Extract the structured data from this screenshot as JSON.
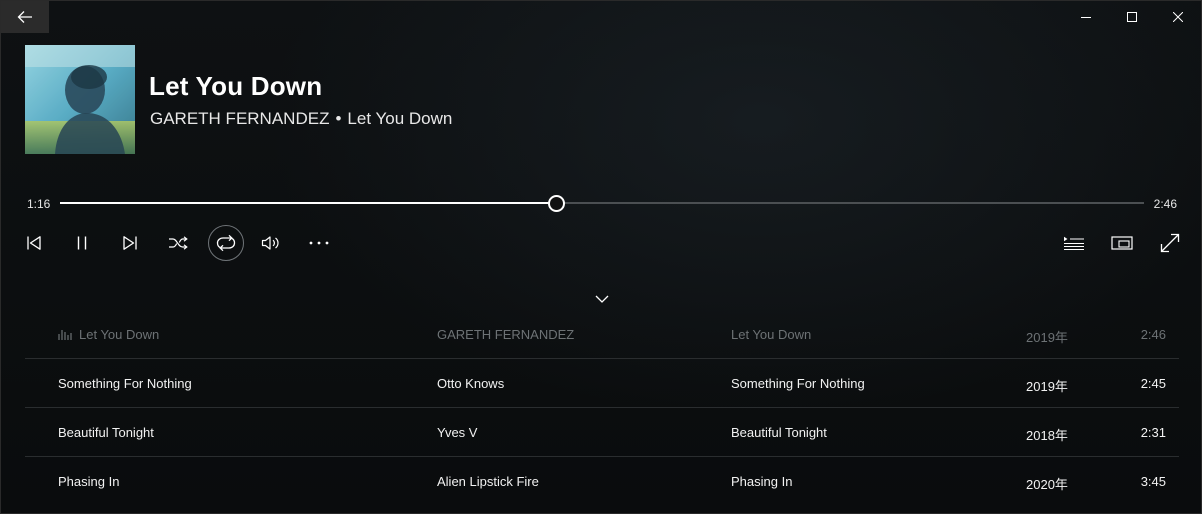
{
  "window": {
    "back_icon": "arrow-left-icon"
  },
  "now_playing": {
    "title": "Let You Down",
    "artist": "GARETH FERNANDEZ",
    "separator": "•",
    "album": "Let You Down",
    "elapsed": "1:16",
    "duration": "2:46",
    "progress_fraction": 0.4578
  },
  "controls": {
    "previous": "skip-previous-icon",
    "pause": "pause-icon",
    "next": "skip-next-icon",
    "shuffle": "shuffle-icon",
    "repeat": "repeat-icon",
    "volume": "volume-icon",
    "more": "more-icon",
    "queue": "now-playing-list-icon",
    "mini_player": "mini-player-icon",
    "full_screen": "full-screen-icon",
    "collapse": "chevron-down-icon"
  },
  "queue": [
    {
      "title": "Let You Down",
      "artist": "GARETH FERNANDEZ",
      "album": "Let You Down",
      "year": "2019年",
      "duration": "2:46",
      "current": true
    },
    {
      "title": "Something For Nothing",
      "artist": "Otto Knows",
      "album": "Something For Nothing",
      "year": "2019年",
      "duration": "2:45"
    },
    {
      "title": "Beautiful Tonight",
      "artist": "Yves V",
      "album": "Beautiful Tonight",
      "year": "2018年",
      "duration": "2:31"
    },
    {
      "title": "Phasing In",
      "artist": "Alien Lipstick Fire",
      "album": "Phasing In",
      "year": "2020年",
      "duration": "3:45"
    }
  ],
  "colors": {
    "accent": "#ffffff",
    "track": "#4b4f52",
    "dim_text": "#6d7275"
  }
}
